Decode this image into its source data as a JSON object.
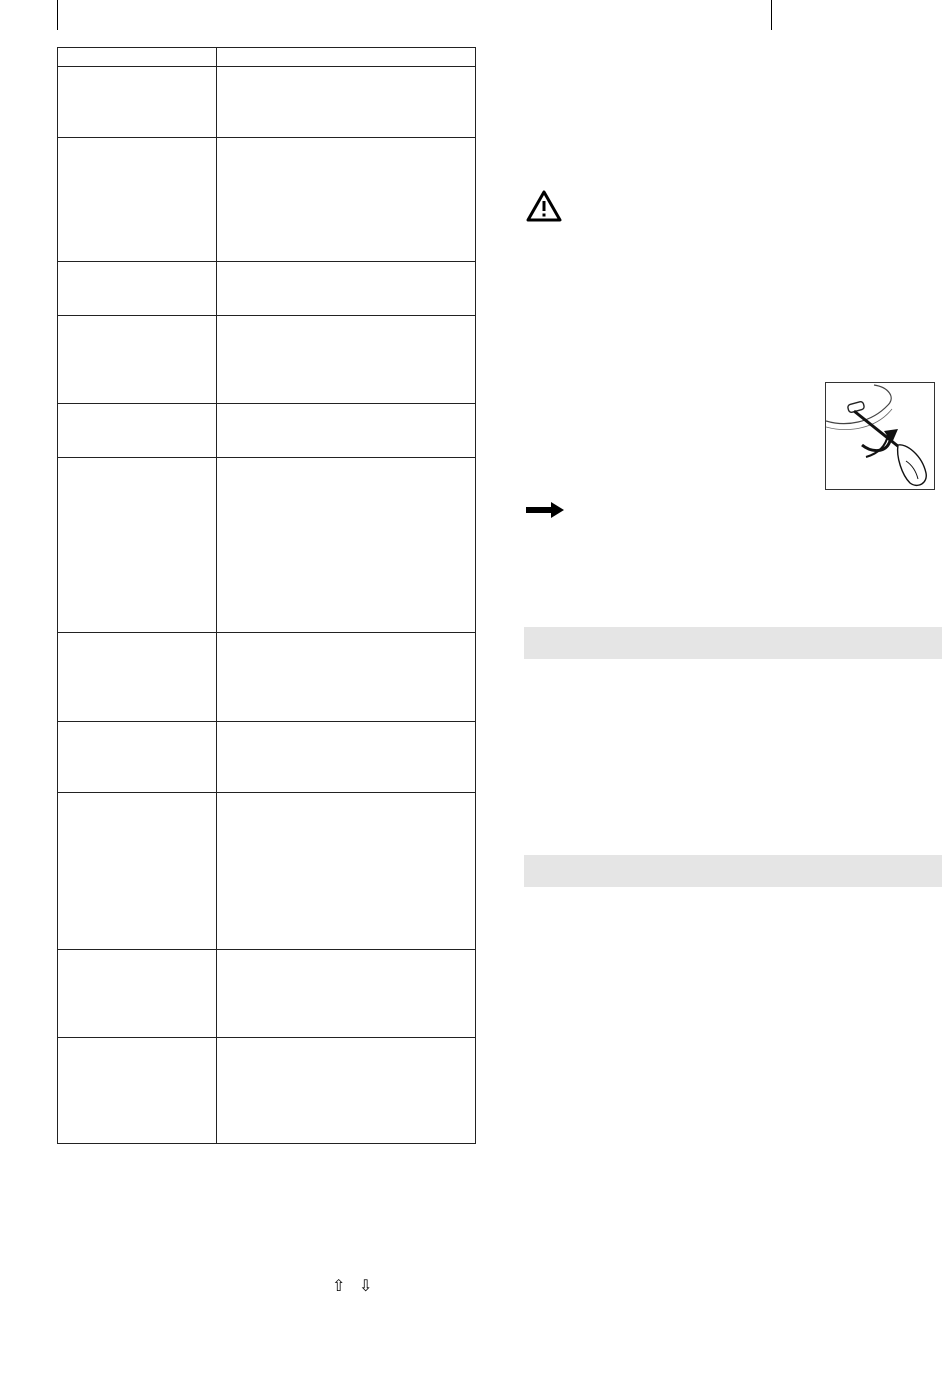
{
  "table": {
    "rows": [
      {
        "left": "",
        "right": ""
      },
      {
        "left": "",
        "right": ""
      },
      {
        "left": "",
        "right": ""
      },
      {
        "left": "",
        "right": ""
      },
      {
        "left": "",
        "right": ""
      },
      {
        "left": "",
        "right": ""
      },
      {
        "left": "",
        "right": ""
      },
      {
        "left": "",
        "right": ""
      },
      {
        "left": "",
        "right": ""
      },
      {
        "left": "",
        "right": ""
      },
      {
        "left": "",
        "right": ""
      },
      {
        "left": "",
        "right": ""
      }
    ]
  },
  "icons": {
    "warning": "warning-triangle-icon",
    "arrow": "right-arrow-icon",
    "up": "up-arrow-icon",
    "down": "down-arrow-icon"
  },
  "symbols": {
    "up": "⇧",
    "down": "⇩"
  },
  "sections": [
    {
      "title": ""
    },
    {
      "title": ""
    }
  ],
  "colors": {
    "band": "#e5e5e5",
    "ink": "#000000"
  }
}
